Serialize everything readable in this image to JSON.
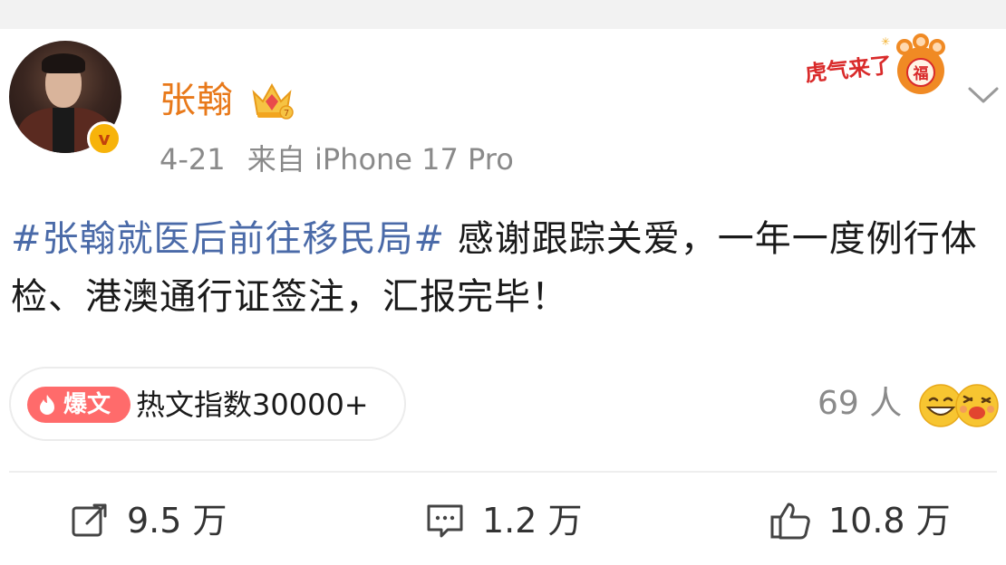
{
  "post": {
    "author": "张翰",
    "date": "4-21",
    "source": "来自 iPhone 17 Pro",
    "hashtag": "#张翰就医后前往移民局#",
    "text": " 感谢跟踪关爱，一年一度例行体检、港澳通行证签注，汇报完毕！",
    "verified_icon": "v-badge-icon",
    "crown_icon": "crown-icon",
    "sticker": {
      "lettering": "虎气来了",
      "icon": "tiger-paw-sticker"
    }
  },
  "hot_index": {
    "tag": "爆文",
    "label": "热文指数30000+"
  },
  "reactions": {
    "count": "69 人",
    "emoji_icons": [
      "grin-emoji-icon",
      "laugh-emoji-icon"
    ]
  },
  "actions": {
    "repost": "9.5 万",
    "comment": "1.2 万",
    "like": "10.8 万"
  },
  "colors": {
    "username": "#e8791a",
    "hashtag": "#4a6aa8",
    "hot_tag": "#ff6b6b",
    "meta_text": "#8a8a8a"
  }
}
